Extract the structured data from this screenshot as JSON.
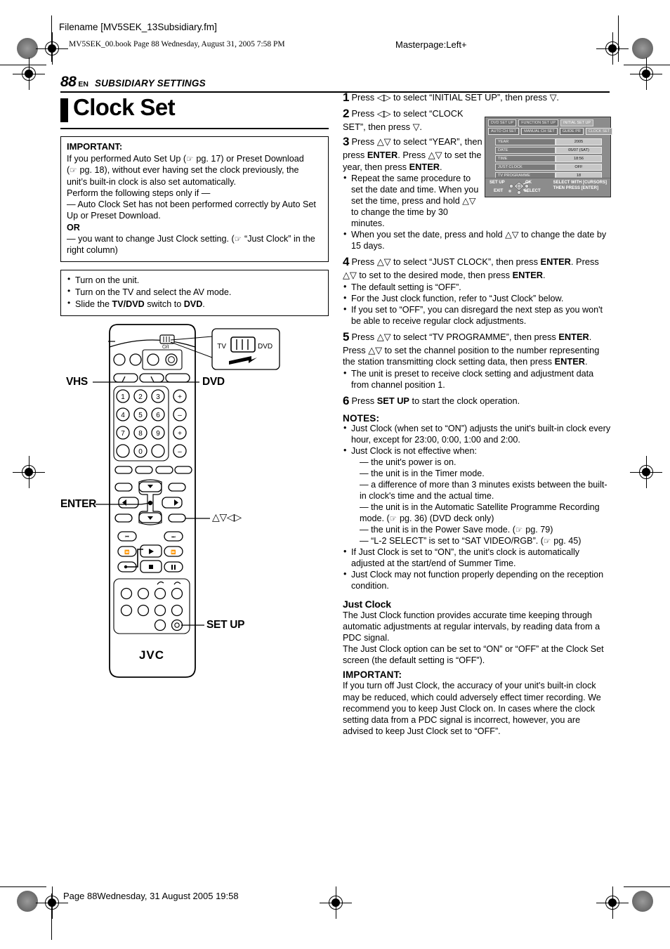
{
  "header": {
    "filename": "Filename [MV5SEK_13Subsidiary.fm]",
    "book_line": "MV5SEK_00.book  Page 88  Wednesday, August 31, 2005  7:58 PM",
    "masterpage": "Masterpage:Left+"
  },
  "running_head": {
    "page_number": "88",
    "lang": "EN",
    "section": "SUBSIDIARY SETTINGS"
  },
  "title": "Clock Set",
  "important_box": {
    "heading": "IMPORTANT:",
    "lines": [
      "If you performed Auto Set Up (☞ pg. 17) or Preset Download",
      "(☞ pg. 18), without ever having set the clock previously, the",
      "unit's built-in clock is also set automatically.",
      "Perform the following steps only if —",
      "— Auto Clock Set has not been performed correctly by Auto Set",
      "Up or Preset Download.",
      "OR",
      "— you want to change Just Clock setting. (☞ “Just Clock” in the",
      "right column)"
    ],
    "or_label": "OR"
  },
  "prep_box": {
    "items": [
      "Turn on the unit.",
      "Turn on the TV and select the AV mode.",
      "Slide the TV/DVD switch to DVD."
    ]
  },
  "remote": {
    "labels": {
      "vhs": "VHS",
      "dvd": "DVD",
      "enter": "ENTER",
      "setup": "SET UP",
      "cursors": "△▽◁▷"
    },
    "switch_callout": {
      "left": "TV",
      "right": "DVD"
    },
    "power_symbol": "⏻/I",
    "brand": "JVC",
    "keypad": [
      "1",
      "2",
      "3",
      "4",
      "5",
      "6",
      "7",
      "8",
      "9",
      "0"
    ],
    "plusminus": [
      "+",
      "–",
      "+",
      "–"
    ]
  },
  "steps": [
    {
      "num": "1",
      "text": "Press ◁▷ to select “INITIAL SET UP”, then press ▽."
    },
    {
      "num": "2",
      "text": "Press ◁▷ to select “CLOCK SET”, then press ▽."
    },
    {
      "num": "3",
      "text": "Press △▽ to select “YEAR”, then press ENTER. Press △▽ to set the year, then press ENTER.",
      "bullets": [
        "Repeat the same procedure to set the date and time. When you set the time, press and hold △▽ to change the time by 30 minutes.",
        "When you set the date, press and hold △▽ to change the date by 15 days."
      ]
    },
    {
      "num": "4",
      "text": "Press △▽ to select “JUST CLOCK”, then press ENTER. Press △▽ to set to the desired mode, then press ENTER.",
      "bullets": [
        "The default setting is “OFF”.",
        "For the Just clock function, refer to “Just Clock” below.",
        "If you set to “OFF”, you can disregard the next step as you won't be able to receive regular clock adjustments."
      ]
    },
    {
      "num": "5",
      "text": "Press △▽ to select “TV PROGRAMME”, then press ENTER. Press △▽ to set the channel position to the number representing the station transmitting clock setting data, then press ENTER.",
      "bullets": [
        "The unit is preset to receive clock setting and adjustment data from channel position 1."
      ]
    },
    {
      "num": "6",
      "text": "Press SET UP to start the clock operation."
    }
  ],
  "osd": {
    "tabs_row1": [
      "DVD SET UP",
      "FUNCTION SET UP",
      "INITIAL SET UP"
    ],
    "tabs_row1_active": "INITIAL SET UP",
    "tabs_row2": [
      "AUTO CH SET",
      "MANUAL CH SET",
      "GUIDE PR",
      "CLOCK SET"
    ],
    "tabs_row2_active": "CLOCK SET",
    "rows": [
      {
        "key": "YEAR",
        "value": "2005"
      },
      {
        "key": "DATE",
        "value": "05/07 (SAT)"
      },
      {
        "key": "TIME",
        "value": "18:56"
      },
      {
        "key": "JUST CLOCK",
        "value": "OFF"
      },
      {
        "key": "TV PROGRAMME",
        "value": "18"
      }
    ],
    "footer": {
      "setup": "SET UP",
      "exit": "EXIT",
      "ok": "OK",
      "select": "SELECT",
      "hint_line1": "SELECT WITH [CURSORS]",
      "hint_line2": "THEN PRESS [ENTER]"
    }
  },
  "notes": {
    "heading": "NOTES:",
    "items": [
      {
        "text": "Just Clock (when set to “ON”) adjusts the unit's built-in clock every hour, except for 23:00, 0:00, 1:00 and 2:00."
      },
      {
        "text": "Just Clock is not effective when:",
        "sub": [
          "— the unit's power is on.",
          "— the unit is in the Timer mode.",
          "— a difference of more than 3 minutes exists between the built-in clock's time and the actual time.",
          "— the unit is in the Automatic Satellite Programme Recording mode. (☞ pg. 36) (DVD deck only)",
          "— the unit is in the Power Save mode. (☞ pg. 79)",
          "— “L-2 SELECT” is set to “SAT VIDEO/RGB”. (☞ pg. 45)"
        ]
      },
      {
        "text": "If Just Clock is set to “ON”, the unit's clock is automatically adjusted at the start/end of Summer Time."
      },
      {
        "text": "Just Clock may not function properly depending on the reception condition."
      }
    ]
  },
  "just_clock": {
    "heading": "Just Clock",
    "para1": "The Just Clock function provides accurate time keeping through automatic adjustments at regular intervals, by reading data from a PDC signal.",
    "para2": "The Just Clock option can be set to “ON” or “OFF” at the Clock Set screen (the default setting is “OFF”).",
    "important_heading": "IMPORTANT:",
    "important_text": "If you turn off Just Clock, the accuracy of your unit's built-in clock may be reduced, which could adversely effect timer recording. We recommend you to keep Just Clock on. In cases where the clock setting data from a PDC signal is incorrect, however, you are advised to keep Just Clock set to “OFF”."
  },
  "footer": "Page 88Wednesday, 31 August 2005  19:58"
}
